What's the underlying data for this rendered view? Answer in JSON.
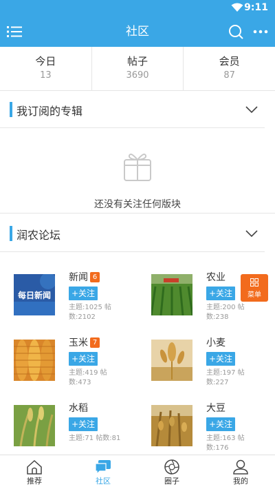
{
  "status_bar": {
    "time": "9:11"
  },
  "app_bar": {
    "title": "社区",
    "menu_icon": "list-menu-icon",
    "search_icon": "search-icon",
    "more_icon": "more-dots-icon"
  },
  "stats": [
    {
      "label": "今日",
      "value": "13"
    },
    {
      "label": "帖子",
      "value": "3690"
    },
    {
      "label": "会员",
      "value": "87"
    }
  ],
  "subscribed": {
    "title": "我订阅的专辑",
    "empty_icon": "gift-box-icon",
    "empty_text": "还没有关注任何版块"
  },
  "forum": {
    "title": "润农论坛",
    "follow_label": "+关注",
    "items": [
      {
        "name": "新闻",
        "badge": "6",
        "thumb_text": "每日新闻",
        "meta": "主题:1025 帖数:2102"
      },
      {
        "name": "农业",
        "badge": "",
        "meta": "主题:200 帖数:238"
      },
      {
        "name": "玉米",
        "badge": "7",
        "meta": "主题:419 帖数:473"
      },
      {
        "name": "小麦",
        "badge": "",
        "meta": "主题:197 帖数:227"
      },
      {
        "name": "水稻",
        "badge": "",
        "meta": "主题:71 帖数:81"
      },
      {
        "name": "大豆",
        "badge": "",
        "meta": "主题:163 帖数:176"
      }
    ]
  },
  "fab": {
    "label": "菜单",
    "icon": "grid-menu-icon"
  },
  "tabs": [
    {
      "label": "推荐",
      "icon": "home-icon",
      "active": false
    },
    {
      "label": "社区",
      "icon": "chat-icon",
      "active": true
    },
    {
      "label": "圈子",
      "icon": "camera-lens-icon",
      "active": false
    },
    {
      "label": "我的",
      "icon": "person-icon",
      "active": false
    }
  ],
  "colors": {
    "primary": "#3aa7e6",
    "badge": "#f26b1d",
    "divider": "#e5e5e5"
  }
}
